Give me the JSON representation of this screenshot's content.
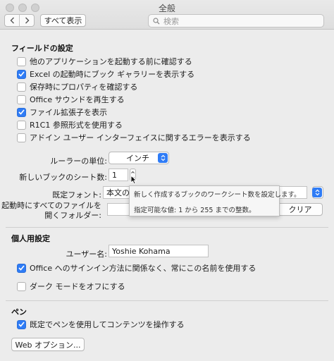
{
  "window": {
    "title": "全般"
  },
  "toolbar": {
    "show_all_label": "すべて表示",
    "search_placeholder": "検索"
  },
  "fields": {
    "section_title": "フィールドの設定",
    "checkboxes": [
      {
        "label": "他のアプリケーションを起動する前に確認する",
        "checked": false
      },
      {
        "label": "Excel の起動時にブック ギャラリーを表示する",
        "checked": true
      },
      {
        "label": "保存時にプロパティを確認する",
        "checked": false
      },
      {
        "label": "Office サウンドを再生する",
        "checked": false
      },
      {
        "label": "ファイル拡張子を表示",
        "checked": true
      },
      {
        "label": "R1C1 参照形式を使用する",
        "checked": false
      },
      {
        "label": "アドイン ユーザー インターフェイスに関するエラーを表示する",
        "checked": false
      }
    ],
    "ruler_label": "ルーラーの単位:",
    "ruler_value": "インチ",
    "sheets_label": "新しいブックのシート数:",
    "sheets_value": "1",
    "font_label": "既定フォント:",
    "font_value": "本文の",
    "startup_label_1": "起動時にすべてのファイルを",
    "startup_label_2": "開くフォルダー:",
    "clear_label": "クリア"
  },
  "tooltip": {
    "line1": "新しく作成するブックのワークシート数を設定します。",
    "line2": "指定可能な値: 1 から 255 までの整数。"
  },
  "personal": {
    "section_title": "個人用設定",
    "username_label": "ユーザー名:",
    "username_value": "Yoshie Kohama",
    "checkboxes": [
      {
        "label": "Office へのサインイン方法に関係なく、常にこの名前を使用する",
        "checked": true
      },
      {
        "label": "ダーク モードをオフにする",
        "checked": false
      }
    ]
  },
  "pen": {
    "section_title": "ペン",
    "checkbox": {
      "label": "既定でペンを使用してコンテンツを操作する",
      "checked": true
    },
    "web_options_label": "Web オプション..."
  },
  "colors": {
    "accent": "#2f7cf6",
    "window_bg": "#ececec"
  }
}
